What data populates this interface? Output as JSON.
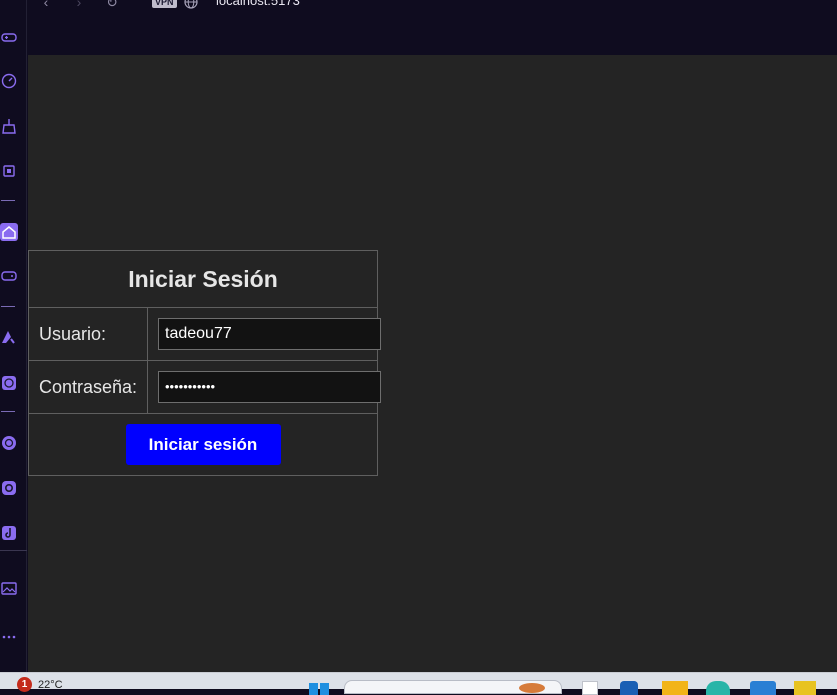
{
  "browser": {
    "vpn_label": "VPN",
    "url": "localhost:5173"
  },
  "sidebar": {
    "icons": [
      "gamepad-icon",
      "speedometer-icon",
      "broom-icon",
      "chip-icon",
      "home-icon",
      "controller-icon",
      "aria-icon",
      "chatgpt-icon",
      "whatsapp-icon",
      "instagram-icon",
      "tiktok-icon",
      "gallery-icon",
      "more-icon"
    ]
  },
  "login": {
    "title": "Iniciar Sesión",
    "username_label": "Usuario:",
    "username_value": "tadeou77",
    "password_label": "Contraseña:",
    "password_value": "•••••••••••",
    "submit_label": "Iniciar sesión"
  },
  "taskbar": {
    "notification_count": "1",
    "weather": "22°C"
  },
  "colors": {
    "accent": "#8a6cf0",
    "button": "#0000ff",
    "page_bg": "#242424",
    "chrome_bg": "#0f0c1f"
  }
}
